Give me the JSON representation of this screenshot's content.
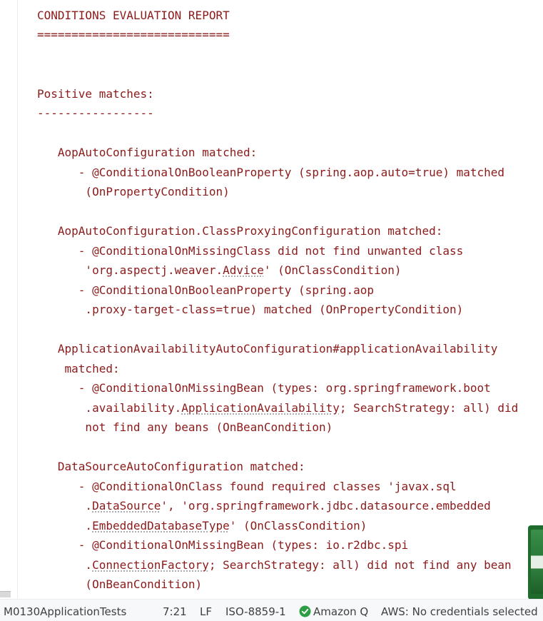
{
  "editor": {
    "lines": [
      "===========================",
      "CONDITIONS EVALUATION REPORT",
      "============================",
      "",
      "",
      "Positive matches:",
      "-----------------",
      "",
      "   AopAutoConfiguration matched:",
      "      - @ConditionalOnBooleanProperty (spring.aop.auto=true) matched",
      "       (OnPropertyCondition)",
      "",
      "   AopAutoConfiguration.ClassProxyingConfiguration matched:",
      "      - @ConditionalOnMissingClass did not find unwanted class",
      "       'org.aspectj.weaver.Advice' (OnClassCondition)",
      "      - @ConditionalOnBooleanProperty (spring.aop",
      "       .proxy-target-class=true) matched (OnPropertyCondition)",
      "",
      "   ApplicationAvailabilityAutoConfiguration#applicationAvailability",
      "    matched:",
      "      - @ConditionalOnMissingBean (types: org.springframework.boot",
      "       .availability.ApplicationAvailability; SearchStrategy: all) did",
      "       not find any beans (OnBeanCondition)",
      "",
      "   DataSourceAutoConfiguration matched:",
      "      - @ConditionalOnClass found required classes 'javax.sql",
      "       .DataSource', 'org.springframework.jdbc.datasource.embedded",
      "       .EmbeddedDatabaseType' (OnClassCondition)",
      "      - @ConditionalOnMissingBean (types: io.r2dbc.spi",
      "       .ConnectionFactory; SearchStrategy: all) did not find any bean",
      "       (OnBeanCondition)"
    ]
  },
  "statusbar": {
    "file": "M0130ApplicationTests",
    "position": "7:21",
    "line_separator": "LF",
    "encoding": "ISO-8859-1",
    "amazon_q": "Amazon Q",
    "aws": "AWS: No credentials selected",
    "check_color": "#2e9e44"
  }
}
